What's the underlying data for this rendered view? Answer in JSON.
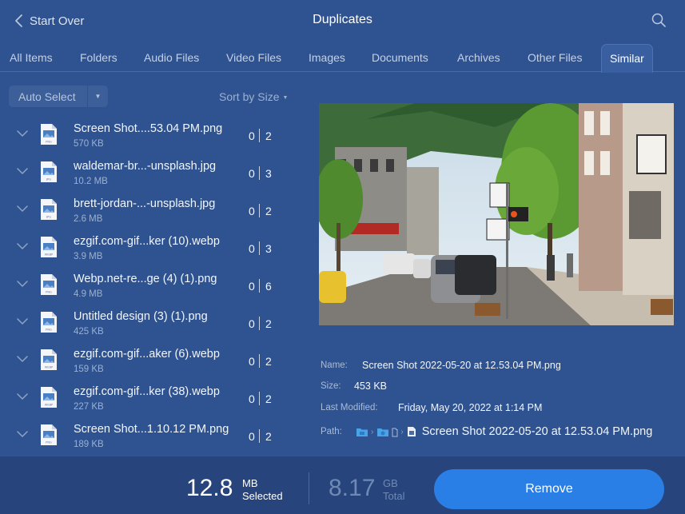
{
  "header": {
    "back_label": "Start Over",
    "title": "Duplicates"
  },
  "tabs": [
    "All Items",
    "Folders",
    "Audio Files",
    "Video Files",
    "Images",
    "Documents",
    "Archives",
    "Other Files",
    "Similar"
  ],
  "active_tab": "Similar",
  "controls": {
    "auto_select": "Auto Select",
    "sort": "Sort by Size"
  },
  "files": [
    {
      "name": "Screen Shot....53.04 PM.png",
      "size": "570 KB",
      "type": "PNG",
      "selected": "0",
      "total": "2"
    },
    {
      "name": "waldemar-br...-unsplash.jpg",
      "size": "10.2 MB",
      "type": "JPG",
      "selected": "0",
      "total": "3"
    },
    {
      "name": "brett-jordan-...-unsplash.jpg",
      "size": "2.6 MB",
      "type": "JPG",
      "selected": "0",
      "total": "2"
    },
    {
      "name": "ezgif.com-gif...ker (10).webp",
      "size": "3.9 MB",
      "type": "WEBP",
      "selected": "0",
      "total": "3"
    },
    {
      "name": "Webp.net-re...ge (4) (1).png",
      "size": "4.9 MB",
      "type": "PNG",
      "selected": "0",
      "total": "6"
    },
    {
      "name": "Untitled design (3) (1).png",
      "size": "425 KB",
      "type": "PNG",
      "selected": "0",
      "total": "2"
    },
    {
      "name": "ezgif.com-gif...aker (6).webp",
      "size": "159 KB",
      "type": "WEBP",
      "selected": "0",
      "total": "2"
    },
    {
      "name": "ezgif.com-gif...ker (38).webp",
      "size": "227 KB",
      "type": "WEBP",
      "selected": "0",
      "total": "2"
    },
    {
      "name": "Screen Shot...1.10.12 PM.png",
      "size": "189 KB",
      "type": "PNG",
      "selected": "0",
      "total": "2"
    }
  ],
  "details": {
    "name_label": "Name:",
    "name_value": "Screen Shot 2022-05-20 at 12.53.04 PM.png",
    "size_label": "Size:",
    "size_value": "453 KB",
    "modified_label": "Last Modified:",
    "modified_value": "Friday, May 20, 2022 at 1:14 PM",
    "path_label": "Path:",
    "path_file": "Screen Shot 2022-05-20 at 12.53.04 PM.png"
  },
  "footer": {
    "selected_value": "12.8",
    "selected_unit": "MB",
    "selected_label": "Selected",
    "total_value": "8.17",
    "total_unit": "GB",
    "total_label": "Total",
    "remove_label": "Remove"
  },
  "colors": {
    "background": "#2f5390",
    "footer": "#27457c",
    "accent": "#2a7fe6"
  }
}
